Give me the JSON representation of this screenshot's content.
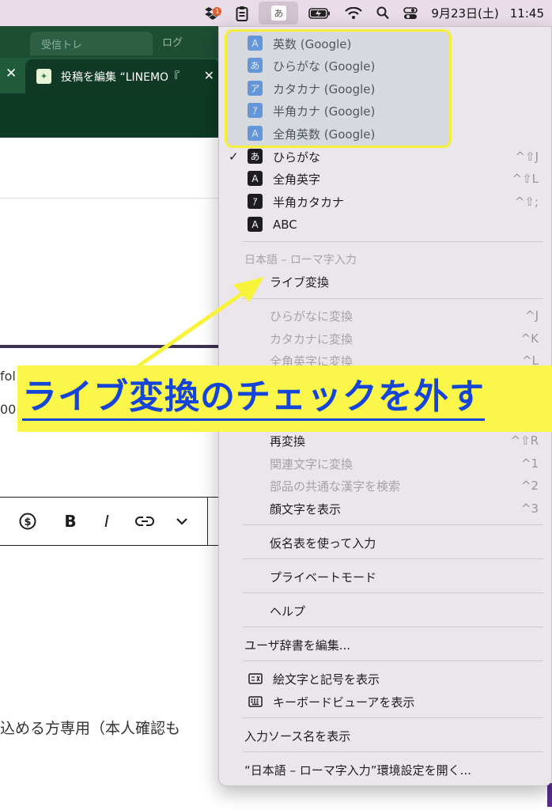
{
  "menubar": {
    "ime_glyph": "あ",
    "dropbox_badge": "1",
    "date": "9月23日(土)",
    "time": "11:45"
  },
  "browser": {
    "ghost_tab_title": "受信トレ",
    "ghost_tab2_title": "ログ",
    "active_tab_title": "投稿を編集 “LINEMO『",
    "tab_close_glyph": "✕"
  },
  "page": {
    "fragment_1": "fol",
    "fragment_2": "00",
    "editor_buttons": [
      "$",
      "B",
      "I",
      "⊂⊃",
      "⌄"
    ],
    "body_text": "込める方専用（本人確認も"
  },
  "menu": {
    "google_sources": [
      {
        "icon": "A",
        "label": "英数 (Google)"
      },
      {
        "icon": "あ",
        "label": "ひらがな (Google)"
      },
      {
        "icon": "ア",
        "label": "カタカナ (Google)"
      },
      {
        "icon": "ｱ",
        "label": "半角カナ (Google)"
      },
      {
        "icon": "A",
        "label": "全角英数 (Google)"
      }
    ],
    "input_modes": [
      {
        "icon": "あ",
        "label": "ひらがな",
        "shortcut": "^⇧J",
        "checked": "✓"
      },
      {
        "icon": "A",
        "label": "全角英字",
        "shortcut": "^⇧L"
      },
      {
        "icon": "ｱ",
        "label": "半角カタカナ",
        "shortcut": "^⇧;"
      },
      {
        "icon": "A",
        "label": "ABC"
      }
    ],
    "section_header": "日本語 – ローマ字入力",
    "live_conversion": "ライブ変換",
    "convert_items": [
      {
        "label": "ひらがなに変換",
        "shortcut": "^J"
      },
      {
        "label": "カタカナに変換",
        "shortcut": "^K"
      },
      {
        "label": "全角英字に変換",
        "shortcut": "^L"
      }
    ],
    "reconvert": {
      "label": "再変換",
      "shortcut": "^⇧R"
    },
    "related": {
      "label": "関連文字に変換",
      "shortcut": "^1"
    },
    "common_kanji": {
      "label": "部品の共通な漢字を検索",
      "shortcut": "^2"
    },
    "emoticons": {
      "label": "顔文字を表示",
      "shortcut": "^3"
    },
    "kana_table": "仮名表を使って入力",
    "private_mode": "プライベートモード",
    "help": "ヘルプ",
    "user_dictionary": "ユーザ辞書を編集...",
    "emoji_symbols": "絵文字と記号を表示",
    "keyboard_viewer": "キーボードビューアを表示",
    "show_source_name": "入力ソース名を表示",
    "open_preferences": "“日本語 – ローマ字入力”環境設定を開く..."
  },
  "annotation": {
    "callout_text": "ライブ変換のチェックを外す",
    "colors": {
      "highlight": "#f5ee3a",
      "text": "#1544d8"
    }
  }
}
